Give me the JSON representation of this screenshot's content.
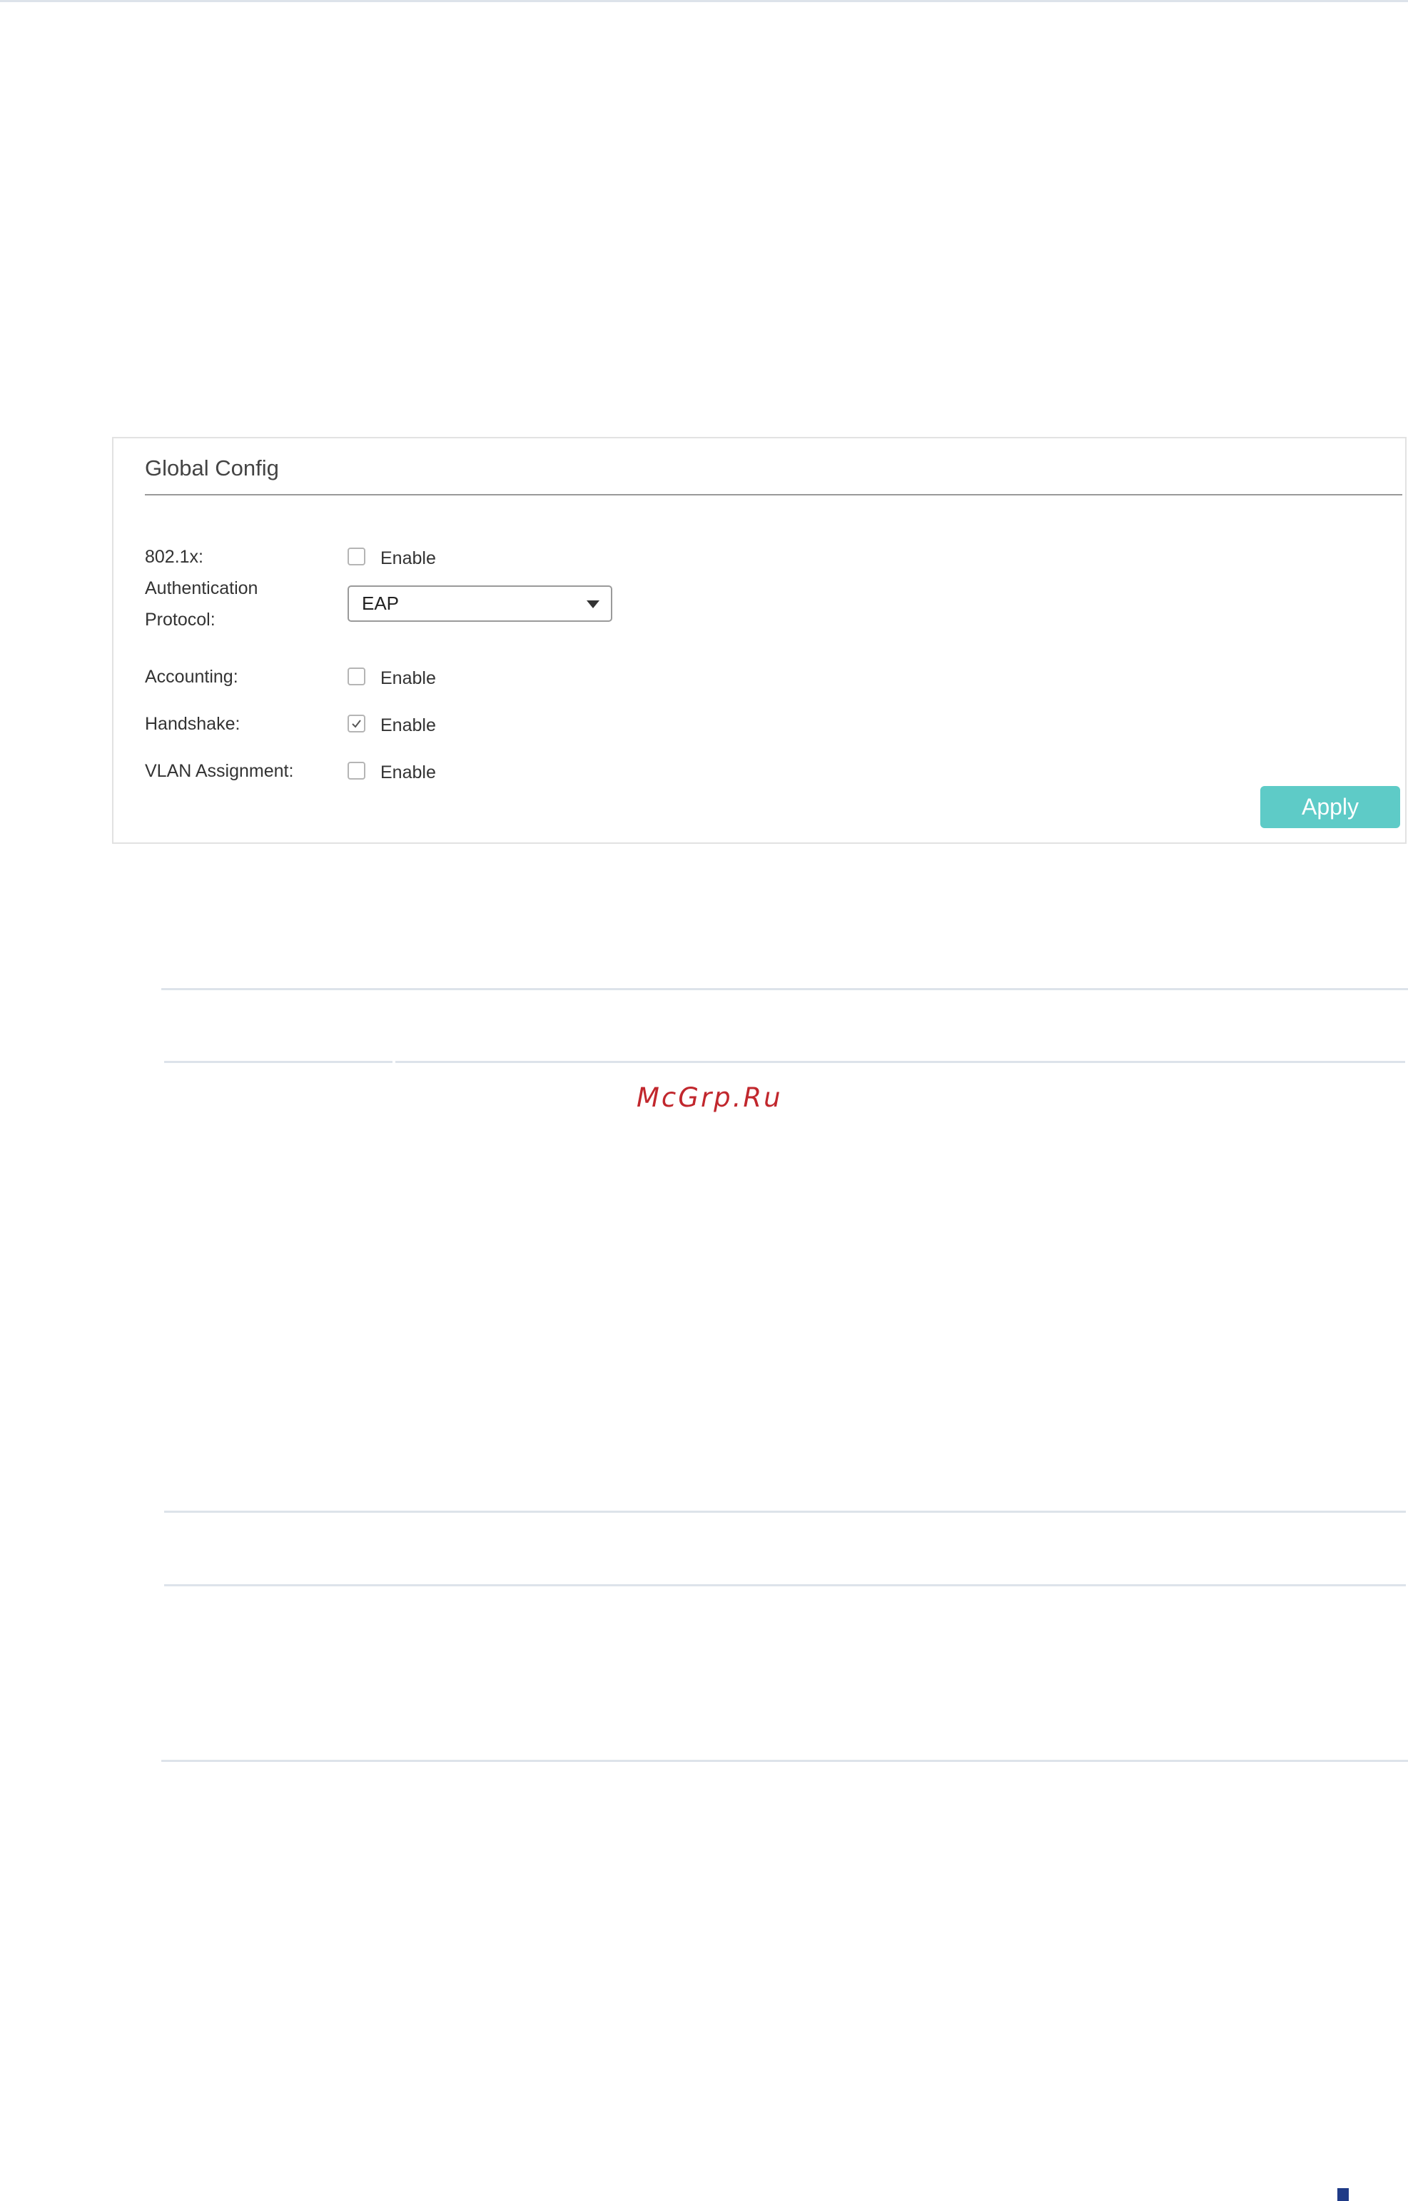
{
  "panel": {
    "title": "Global Config",
    "rows": {
      "dot1x": {
        "label": "802.1x:",
        "checked": false,
        "option_label": "Enable"
      },
      "auth_protocol": {
        "label": "Authentication Protocol:",
        "selected": "EAP"
      },
      "accounting": {
        "label": "Accounting:",
        "checked": false,
        "option_label": "Enable"
      },
      "handshake": {
        "label": "Handshake:",
        "checked": true,
        "option_label": "Enable"
      },
      "vlan_assignment": {
        "label": "VLAN Assignment:",
        "checked": false,
        "option_label": "Enable"
      }
    },
    "apply_label": "Apply"
  },
  "watermark": "McGrp.Ru",
  "colors": {
    "apply_button": "#5ecbc7",
    "watermark": "#c1272d",
    "rule": "#dde3ea",
    "corner_mark": "#1f3b87"
  }
}
